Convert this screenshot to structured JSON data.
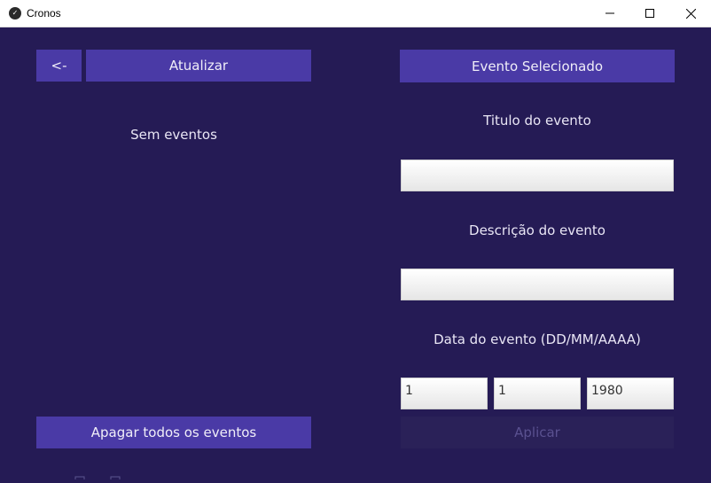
{
  "window": {
    "title": "Cronos",
    "icon": "kivy-icon"
  },
  "left_panel": {
    "back_label": "<-",
    "refresh_label": "Atualizar",
    "empty_text": "Sem eventos",
    "delete_all_label": "Apagar todos os eventos"
  },
  "right_panel": {
    "header_label": "Evento Selecionado",
    "title_label": "Titulo do evento",
    "title_value": "",
    "description_label": "Descrição do evento",
    "description_value": "",
    "date_label": "Data do evento (DD/MM/AAAA)",
    "day_value": "1",
    "month_value": "1",
    "year_value": "1980",
    "apply_label": "Aplicar"
  },
  "colors": {
    "background": "#251b55",
    "button": "#4a3aa6",
    "button_disabled": "#2a2158"
  }
}
